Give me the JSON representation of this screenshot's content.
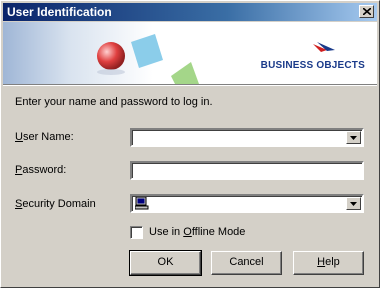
{
  "window": {
    "title": "User Identification"
  },
  "banner": {
    "logo": "BUSINESS OBJECTS",
    "logo_icon": "business-objects-logo"
  },
  "form": {
    "intro": "Enter your name and password to log in.",
    "user_name_label_pre": "",
    "user_name_label_key": "U",
    "user_name_label_post": "ser Name:",
    "password_label_key": "P",
    "password_label_post": "assword:",
    "domain_label_key": "S",
    "domain_label_post": "ecurity Domain",
    "user_name_value": "",
    "password_value": "",
    "domain_value": "",
    "offline_label_pre": "Use in ",
    "offline_label_key": "O",
    "offline_label_post": "ffline Mode",
    "offline_checked": false
  },
  "buttons": {
    "ok": "OK",
    "cancel": "Cancel",
    "help_key": "H",
    "help_post": "elp"
  }
}
